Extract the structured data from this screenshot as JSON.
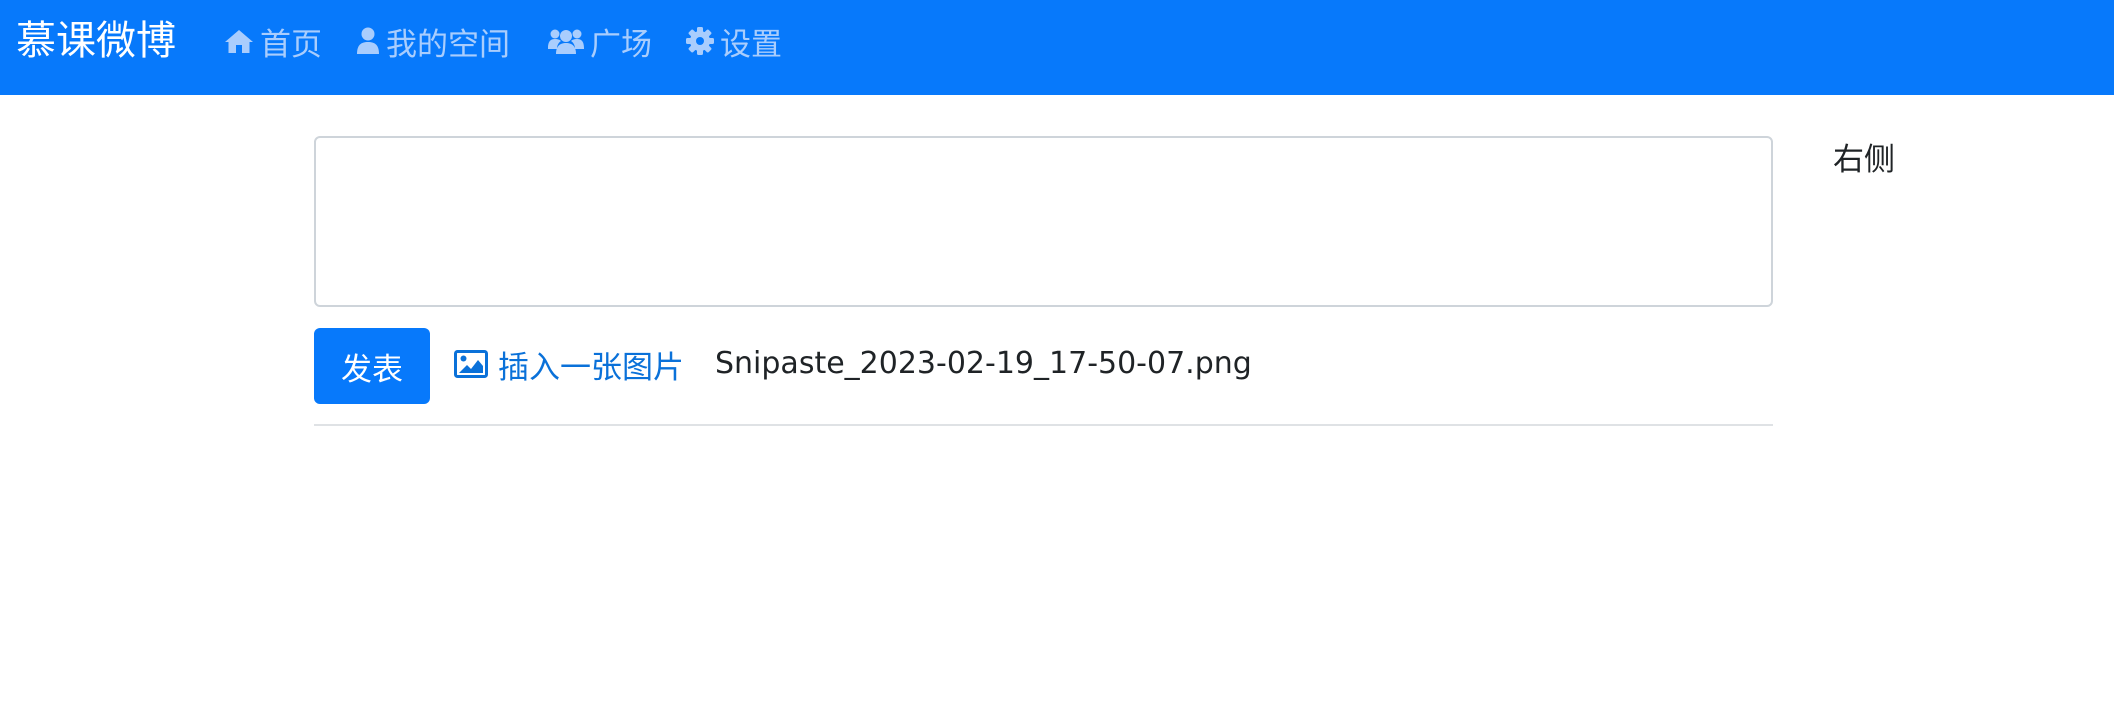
{
  "navbar": {
    "brand": "慕课微博",
    "items": [
      {
        "label": "首页",
        "icon": "home-icon"
      },
      {
        "label": "我的空间",
        "icon": "user-icon"
      },
      {
        "label": "广场",
        "icon": "users-icon"
      },
      {
        "label": "设置",
        "icon": "gear-icon"
      }
    ]
  },
  "composer": {
    "value": "",
    "post_label": "发表",
    "insert_image_label": "插入一张图片",
    "insert_image_icon": "image-icon",
    "selected_file": "Snipaste_2023-02-19_17-50-07.png"
  },
  "sidebar": {
    "label": "右侧"
  },
  "colors": {
    "navbar_bg": "#0779fb",
    "nav_link": "#a9cdfd",
    "primary": "#0779fb",
    "link": "#0a71d9"
  }
}
